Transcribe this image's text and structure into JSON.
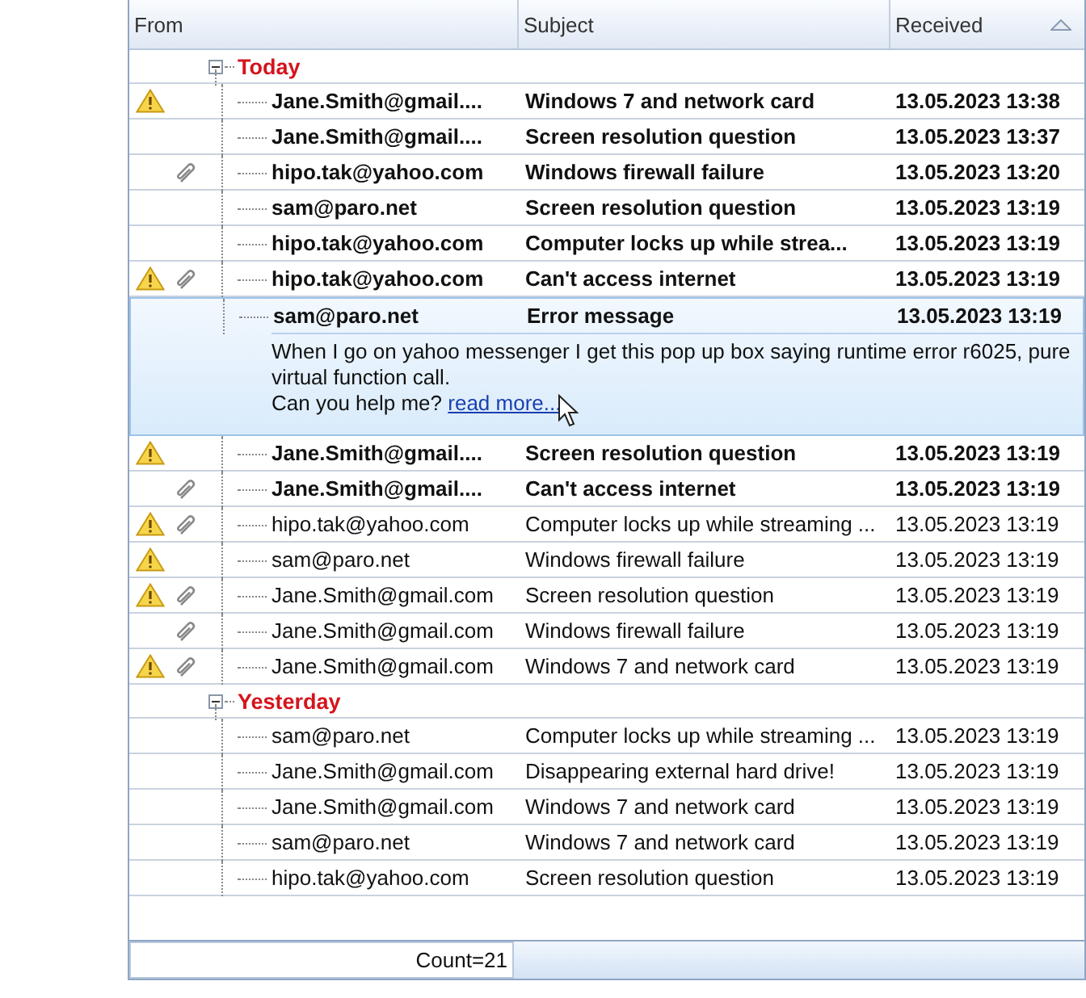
{
  "columns": [
    {
      "label": "From",
      "sorted": false
    },
    {
      "label": "Subject",
      "sorted": false
    },
    {
      "label": "Received",
      "sorted": true
    }
  ],
  "groups": [
    {
      "label": "Today",
      "expanded": true,
      "rows": [
        {
          "from": "Jane.Smith@gmail....",
          "subject": "Windows 7 and network card",
          "received": "13.05.2023 13:38",
          "unread": true,
          "flag": true,
          "attachment": false,
          "selected": false
        },
        {
          "from": "Jane.Smith@gmail....",
          "subject": "Screen resolution question",
          "received": "13.05.2023 13:37",
          "unread": true,
          "flag": false,
          "attachment": false,
          "selected": false
        },
        {
          "from": "hipo.tak@yahoo.com",
          "subject": "Windows firewall failure",
          "received": "13.05.2023 13:20",
          "unread": true,
          "flag": false,
          "attachment": true,
          "selected": false
        },
        {
          "from": "sam@paro.net",
          "subject": "Screen resolution question",
          "received": "13.05.2023 13:19",
          "unread": true,
          "flag": false,
          "attachment": false,
          "selected": false
        },
        {
          "from": "hipo.tak@yahoo.com",
          "subject": "Computer locks up while strea...",
          "received": "13.05.2023 13:19",
          "unread": true,
          "flag": false,
          "attachment": false,
          "selected": false
        },
        {
          "from": "hipo.tak@yahoo.com",
          "subject": "Can't access internet",
          "received": "13.05.2023 13:19",
          "unread": true,
          "flag": true,
          "attachment": true,
          "selected": false
        },
        {
          "from": "sam@paro.net",
          "subject": "Error message",
          "received": "13.05.2023 13:19",
          "unread": true,
          "flag": false,
          "attachment": false,
          "selected": true,
          "preview": "When I go on yahoo messenger I get this pop up box saying runtime error r6025, pure virtual function call.",
          "preview_tail": "Can you help me?",
          "link": "read more..."
        },
        {
          "from": "Jane.Smith@gmail....",
          "subject": "Screen resolution question",
          "received": "13.05.2023 13:19",
          "unread": true,
          "flag": true,
          "attachment": false,
          "selected": false
        },
        {
          "from": "Jane.Smith@gmail....",
          "subject": "Can't access internet",
          "received": "13.05.2023 13:19",
          "unread": true,
          "flag": false,
          "attachment": true,
          "selected": false
        },
        {
          "from": "hipo.tak@yahoo.com",
          "subject": "Computer locks up while streaming ...",
          "received": "13.05.2023 13:19",
          "unread": false,
          "flag": true,
          "attachment": true,
          "selected": false
        },
        {
          "from": "sam@paro.net",
          "subject": "Windows firewall failure",
          "received": "13.05.2023 13:19",
          "unread": false,
          "flag": true,
          "attachment": false,
          "selected": false
        },
        {
          "from": "Jane.Smith@gmail.com",
          "subject": "Screen resolution question",
          "received": "13.05.2023 13:19",
          "unread": false,
          "flag": true,
          "attachment": true,
          "selected": false
        },
        {
          "from": "Jane.Smith@gmail.com",
          "subject": "Windows firewall failure",
          "received": "13.05.2023 13:19",
          "unread": false,
          "flag": false,
          "attachment": true,
          "selected": false
        },
        {
          "from": "Jane.Smith@gmail.com",
          "subject": "Windows 7 and network card",
          "received": "13.05.2023 13:19",
          "unread": false,
          "flag": true,
          "attachment": true,
          "selected": false
        }
      ]
    },
    {
      "label": "Yesterday",
      "expanded": true,
      "rows": [
        {
          "from": "sam@paro.net",
          "subject": "Computer locks up while streaming ...",
          "received": "13.05.2023 13:19",
          "unread": false,
          "flag": false,
          "attachment": false,
          "selected": false
        },
        {
          "from": "Jane.Smith@gmail.com",
          "subject": "Disappearing external hard drive!",
          "received": "13.05.2023 13:19",
          "unread": false,
          "flag": false,
          "attachment": false,
          "selected": false
        },
        {
          "from": "Jane.Smith@gmail.com",
          "subject": "Windows 7 and network card",
          "received": "13.05.2023 13:19",
          "unread": false,
          "flag": false,
          "attachment": false,
          "selected": false
        },
        {
          "from": "sam@paro.net",
          "subject": "Windows 7 and network card",
          "received": "13.05.2023 13:19",
          "unread": false,
          "flag": false,
          "attachment": false,
          "selected": false
        },
        {
          "from": "hipo.tak@yahoo.com",
          "subject": "Screen resolution question",
          "received": "13.05.2023 13:19",
          "unread": false,
          "flag": false,
          "attachment": false,
          "selected": false
        }
      ]
    }
  ],
  "status_bar": {
    "count": "Count=21"
  }
}
